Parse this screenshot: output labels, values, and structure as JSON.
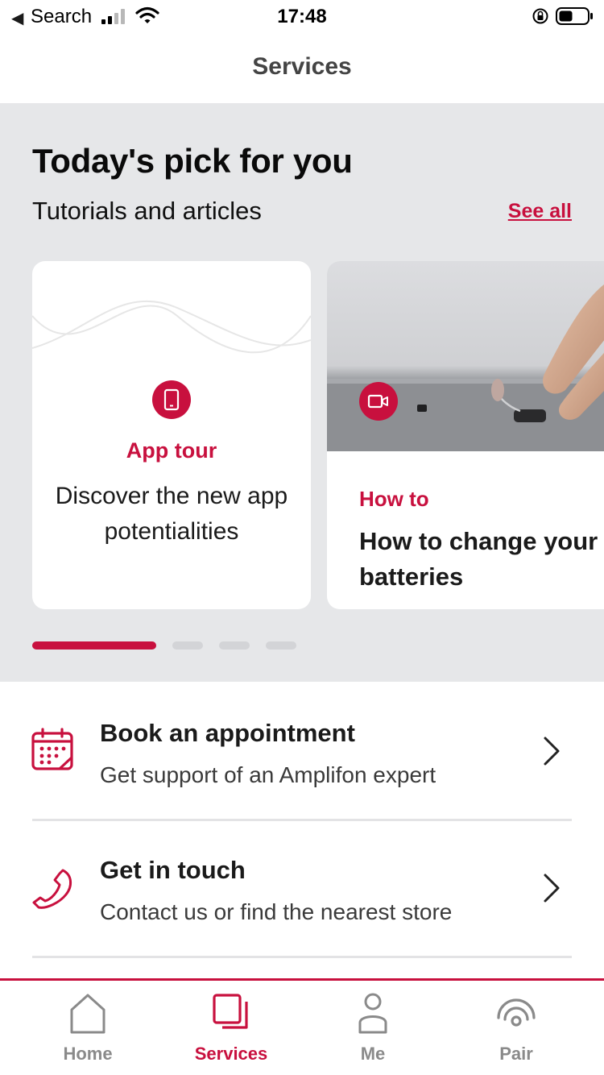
{
  "status_bar": {
    "back_app": "Search",
    "time": "17:48"
  },
  "header": {
    "title": "Services"
  },
  "pick": {
    "title": "Today's pick for you",
    "subtitle": "Tutorials and articles",
    "see_all": "See all",
    "cards": [
      {
        "category": "App tour",
        "description": "Discover the new app potentialities",
        "icon": "smartphone-icon"
      },
      {
        "category": "How to",
        "title": "How to change your batteries",
        "icon": "video-icon"
      }
    ],
    "carousel": {
      "page_count": 4,
      "active_index": 0
    }
  },
  "services": [
    {
      "title": "Book an appointment",
      "subtitle": "Get support of an Amplifon expert",
      "icon": "calendar-icon"
    },
    {
      "title": "Get in touch",
      "subtitle": "Contact us or find the nearest store",
      "icon": "phone-icon"
    }
  ],
  "tab_bar": {
    "active": "Services",
    "tabs": [
      {
        "label": "Home",
        "icon": "home-icon"
      },
      {
        "label": "Services",
        "icon": "services-icon"
      },
      {
        "label": "Me",
        "icon": "person-icon"
      },
      {
        "label": "Pair",
        "icon": "pair-signal-icon"
      }
    ]
  },
  "colors": {
    "accent": "#c8103e",
    "section_background": "#e6e7e9",
    "inactive_tab": "#8a8a8a"
  }
}
